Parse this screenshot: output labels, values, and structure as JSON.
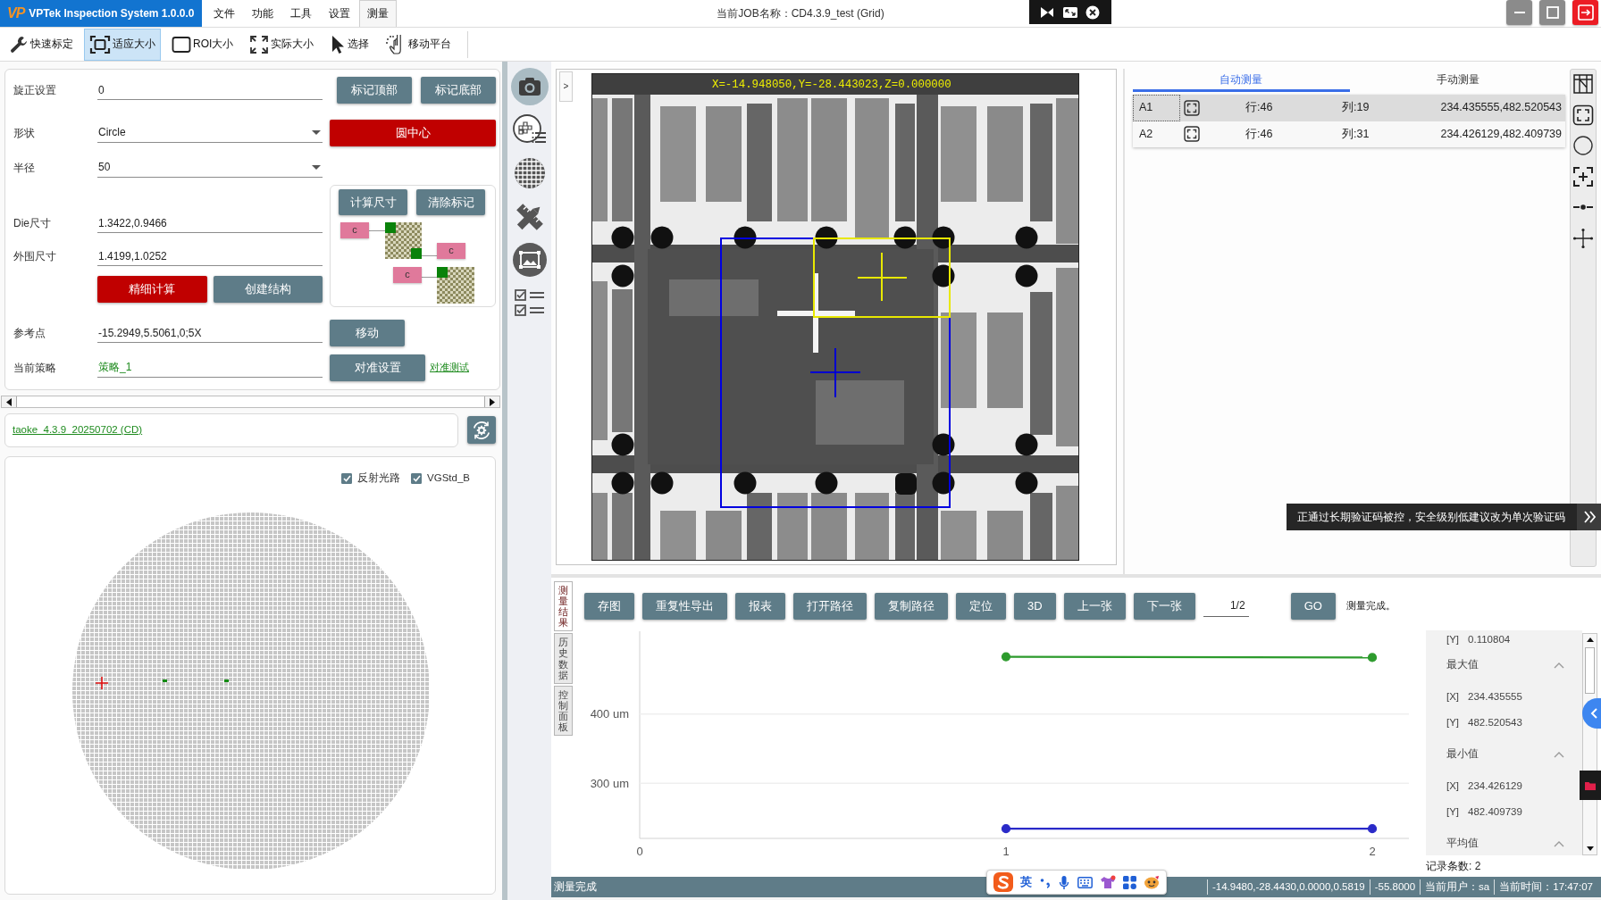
{
  "title_bar": {
    "logo": "VP",
    "app_name": "VPTek Inspection System 1.0.0.0",
    "menu": [
      {
        "label": "文件",
        "selected": false
      },
      {
        "label": "功能",
        "selected": false
      },
      {
        "label": "工具",
        "selected": false
      },
      {
        "label": "设置",
        "selected": false
      },
      {
        "label": "测量",
        "selected": true
      }
    ],
    "job_title": "当前JOB名称：CD4.3.9_test (Grid)"
  },
  "toolbar": [
    {
      "label": "快速标定",
      "kind": "calibrate",
      "selected": false
    },
    {
      "label": "适应大小",
      "kind": "fit",
      "selected": true
    },
    {
      "label": "ROI大小",
      "kind": "roi",
      "selected": false
    },
    {
      "label": "实际大小",
      "kind": "actual",
      "selected": false
    },
    {
      "label": "选择",
      "kind": "select",
      "selected": false
    },
    {
      "label": "移动平台",
      "kind": "stage",
      "selected": false
    }
  ],
  "settings": {
    "rows": [
      {
        "label": "旋正设置",
        "field": {
          "kind": "text",
          "value": "0"
        },
        "actions": [
          {
            "label": "标记顶部",
            "kind": "default"
          },
          {
            "label": "标记底部",
            "kind": "default"
          }
        ]
      },
      {
        "label": "形状",
        "field": {
          "kind": "select",
          "value": "Circle"
        },
        "actions": [
          {
            "label": "圆中心",
            "kind": "danger"
          }
        ]
      },
      {
        "label": "半径",
        "field": {
          "kind": "select",
          "value": "50"
        }
      },
      {
        "label": "Die尺寸",
        "field": {
          "kind": "text",
          "value": "1.3422,0.9466"
        }
      },
      {
        "label": "外围尺寸",
        "field": {
          "kind": "text",
          "value": "1.4199,1.0252"
        }
      },
      {
        "buttons": [
          {
            "label": "精细计算",
            "kind": "danger"
          },
          {
            "label": "创建结构",
            "kind": "default"
          }
        ]
      },
      {
        "label": "参考点",
        "field": {
          "kind": "text",
          "value": "-15.2949,5.5061,0;5X"
        },
        "actions": [
          {
            "label": "移动",
            "kind": "default"
          }
        ]
      },
      {
        "label": "当前策略",
        "field": {
          "kind": "accent",
          "value": "策略_1"
        },
        "actions": [
          {
            "label": "对准设置",
            "kind": "default"
          }
        ],
        "link": "对准测试"
      }
    ],
    "structure": {
      "buttons": [
        "计算尺寸",
        "清除标记"
      ],
      "tags": [
        "c",
        "c",
        "c"
      ]
    }
  },
  "recipe": {
    "link": "taoke_4.3.9_20250702 (CD)"
  },
  "wafer_map": {
    "options": [
      {
        "label": "反射光路",
        "checked": true
      },
      {
        "label": "VGStd_B",
        "checked": true
      }
    ]
  },
  "image_view": {
    "toggle": ">",
    "readout": "X=-14.948050,Y=-28.443023,Z=0.000000"
  },
  "results": {
    "tabs": [
      {
        "label": "自动测量",
        "selected": true
      },
      {
        "label": "手动测量",
        "selected": false
      }
    ],
    "rows": [
      {
        "name": "A1",
        "row": "行:46",
        "column": "列:19",
        "value": "234.435555,482.520543",
        "selected": true
      },
      {
        "name": "A2",
        "row": "行:46",
        "column": "列:31",
        "value": "234.426129,482.409739",
        "selected": false
      }
    ]
  },
  "notification": {
    "text": "正通过长期验证码被控，安全级别低建议改为单次验证码"
  },
  "bottom_panel": {
    "tabs": [
      {
        "label": "测量结果",
        "selected": true
      },
      {
        "label": "历史数据",
        "selected": false
      },
      {
        "label": "控制面板",
        "selected": false
      }
    ],
    "actions": [
      "存图",
      "重复性导出",
      "报表",
      "打开路径",
      "复制路径",
      "定位",
      "3D",
      "上一张",
      "下一张"
    ],
    "page": "1/2",
    "go": "GO",
    "message": "测量完成。",
    "chart_data": {
      "type": "line",
      "x": [
        1,
        2
      ],
      "series": [
        {
          "color": "#2d9b2d",
          "marker": "circle",
          "values": [
            483,
            482
          ]
        },
        {
          "color": "#2a2ac8",
          "marker": "circle",
          "values": [
            234,
            234
          ]
        }
      ],
      "xlim": [
        0,
        2.1
      ],
      "ylim": [
        220,
        520
      ],
      "xticks": [
        0,
        1,
        2
      ],
      "yticks": [
        {
          "value": 300,
          "label": "300 um"
        },
        {
          "value": 400,
          "label": "400 um"
        }
      ]
    },
    "statistics": {
      "top_row": {
        "axis": "[Y]",
        "value": "0.110804"
      },
      "groups": [
        {
          "title": "最大值",
          "expanded": true,
          "items": [
            {
              "axis": "[X]",
              "value": "234.435555"
            },
            {
              "axis": "[Y]",
              "value": "482.520543"
            }
          ]
        },
        {
          "title": "最小值",
          "expanded": true,
          "items": [
            {
              "axis": "[X]",
              "value": "234.426129"
            },
            {
              "axis": "[Y]",
              "value": "482.409739"
            }
          ]
        },
        {
          "title": "平均值",
          "expanded": true
        }
      ]
    },
    "record_count": "记录条数: 2"
  },
  "status_bar": {
    "message": "测量完成",
    "fields": [
      "-14.9480,-28.4430,0.0000,0.5819",
      "-55.8000",
      "当前用户：sa",
      "当前时间：17:47:07"
    ]
  },
  "ime_bar": {
    "mode": "英"
  }
}
